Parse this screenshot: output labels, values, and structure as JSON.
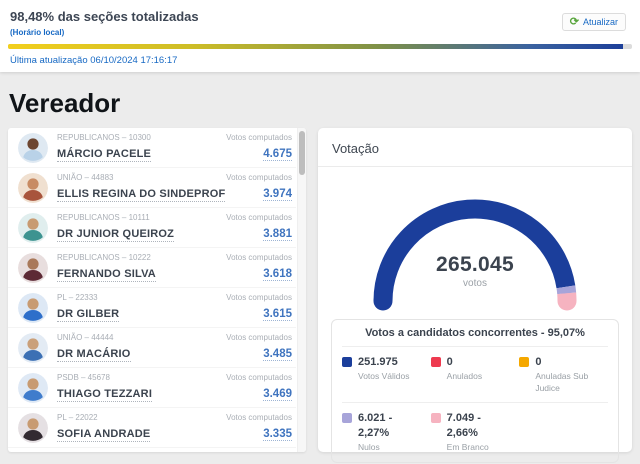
{
  "header": {
    "sections_totalized": "98,48% das seções totalizadas",
    "timezone_note": "(Horário local)",
    "progress_percent": 98.48,
    "last_update": "Última atualização 06/10/2024 17:16:17",
    "refresh_label": "Atualizar"
  },
  "page_title": "Vereador",
  "candidates": {
    "votes_label": "Votos computados",
    "items": [
      {
        "party": "REPUBLICANOS – 10300",
        "name": "MÁRCIO PACELE",
        "votes": "4.675",
        "avatar": {
          "bg": "#dfe9f2",
          "skin": "#6d4631",
          "shirt": "#b9d2e8"
        }
      },
      {
        "party": "UNIÃO – 44883",
        "name": "ELLIS REGINA DO SINDEPROF",
        "votes": "3.974",
        "avatar": {
          "bg": "#f0e0d0",
          "skin": "#c88b63",
          "shirt": "#a8543c"
        }
      },
      {
        "party": "REPUBLICANOS – 10111",
        "name": "DR JUNIOR QUEIROZ",
        "votes": "3.881",
        "avatar": {
          "bg": "#e0eeee",
          "skin": "#c89b72",
          "shirt": "#3d9390"
        }
      },
      {
        "party": "REPUBLICANOS – 10222",
        "name": "FERNANDO SILVA",
        "votes": "3.618",
        "avatar": {
          "bg": "#e8dede",
          "skin": "#a9795a",
          "shirt": "#5d2a35"
        }
      },
      {
        "party": "PL – 22333",
        "name": "DR GILBER",
        "votes": "3.615",
        "avatar": {
          "bg": "#dde8f5",
          "skin": "#c89b72",
          "shirt": "#2e6fca"
        }
      },
      {
        "party": "UNIÃO – 44444",
        "name": "DR MACÁRIO",
        "votes": "3.485",
        "avatar": {
          "bg": "#e3ebf4",
          "skin": "#caa07a",
          "shirt": "#3c70b4"
        }
      },
      {
        "party": "PSDB – 45678",
        "name": "THIAGO TEZZARI",
        "votes": "3.469",
        "avatar": {
          "bg": "#dfe9f5",
          "skin": "#c89b72",
          "shirt": "#3f7ccc"
        }
      },
      {
        "party": "PL – 22022",
        "name": "SOFIA ANDRADE",
        "votes": "3.335",
        "avatar": {
          "bg": "#e5e0e3",
          "skin": "#c89b72",
          "shirt": "#322a31"
        }
      }
    ]
  },
  "votacao": {
    "title": "Votação",
    "total_votes": "265.045",
    "total_label": "votos",
    "legend_title": "Votos a candidatos concorrentes - 95,07%",
    "legend": [
      {
        "value": "251.975",
        "label": "Votos Válidos",
        "color": "#1b3e9b"
      },
      {
        "value": "0",
        "label": "Anulados",
        "color": "#ee3a4f"
      },
      {
        "value": "0",
        "label": "Anuladas Sub Judice",
        "color": "#f5a800"
      },
      {
        "value": "6.021 - 2,27%",
        "label": "Nulos",
        "color": "#a7a4d9"
      },
      {
        "value": "7.049 - 2,66%",
        "label": "Em Branco",
        "color": "#f6b3c0"
      }
    ]
  },
  "chart_data": {
    "type": "gauge",
    "title": "Votação",
    "center_value": 265045,
    "center_label": "votos",
    "layout": "semicircle, 180deg left to right, blue valid votes then nulos (purple) then em branco (pink)",
    "segments": [
      {
        "name": "Votos Válidos",
        "value": 251975,
        "percent": 95.07,
        "color": "#1b3e9b"
      },
      {
        "name": "Anulados",
        "value": 0,
        "percent": 0,
        "color": "#ee3a4f"
      },
      {
        "name": "Anuladas Sub Judice",
        "value": 0,
        "percent": 0,
        "color": "#f5a800"
      },
      {
        "name": "Nulos",
        "value": 6021,
        "percent": 2.27,
        "color": "#a7a4d9"
      },
      {
        "name": "Em Branco",
        "value": 7049,
        "percent": 2.66,
        "color": "#f6b3c0"
      }
    ]
  }
}
